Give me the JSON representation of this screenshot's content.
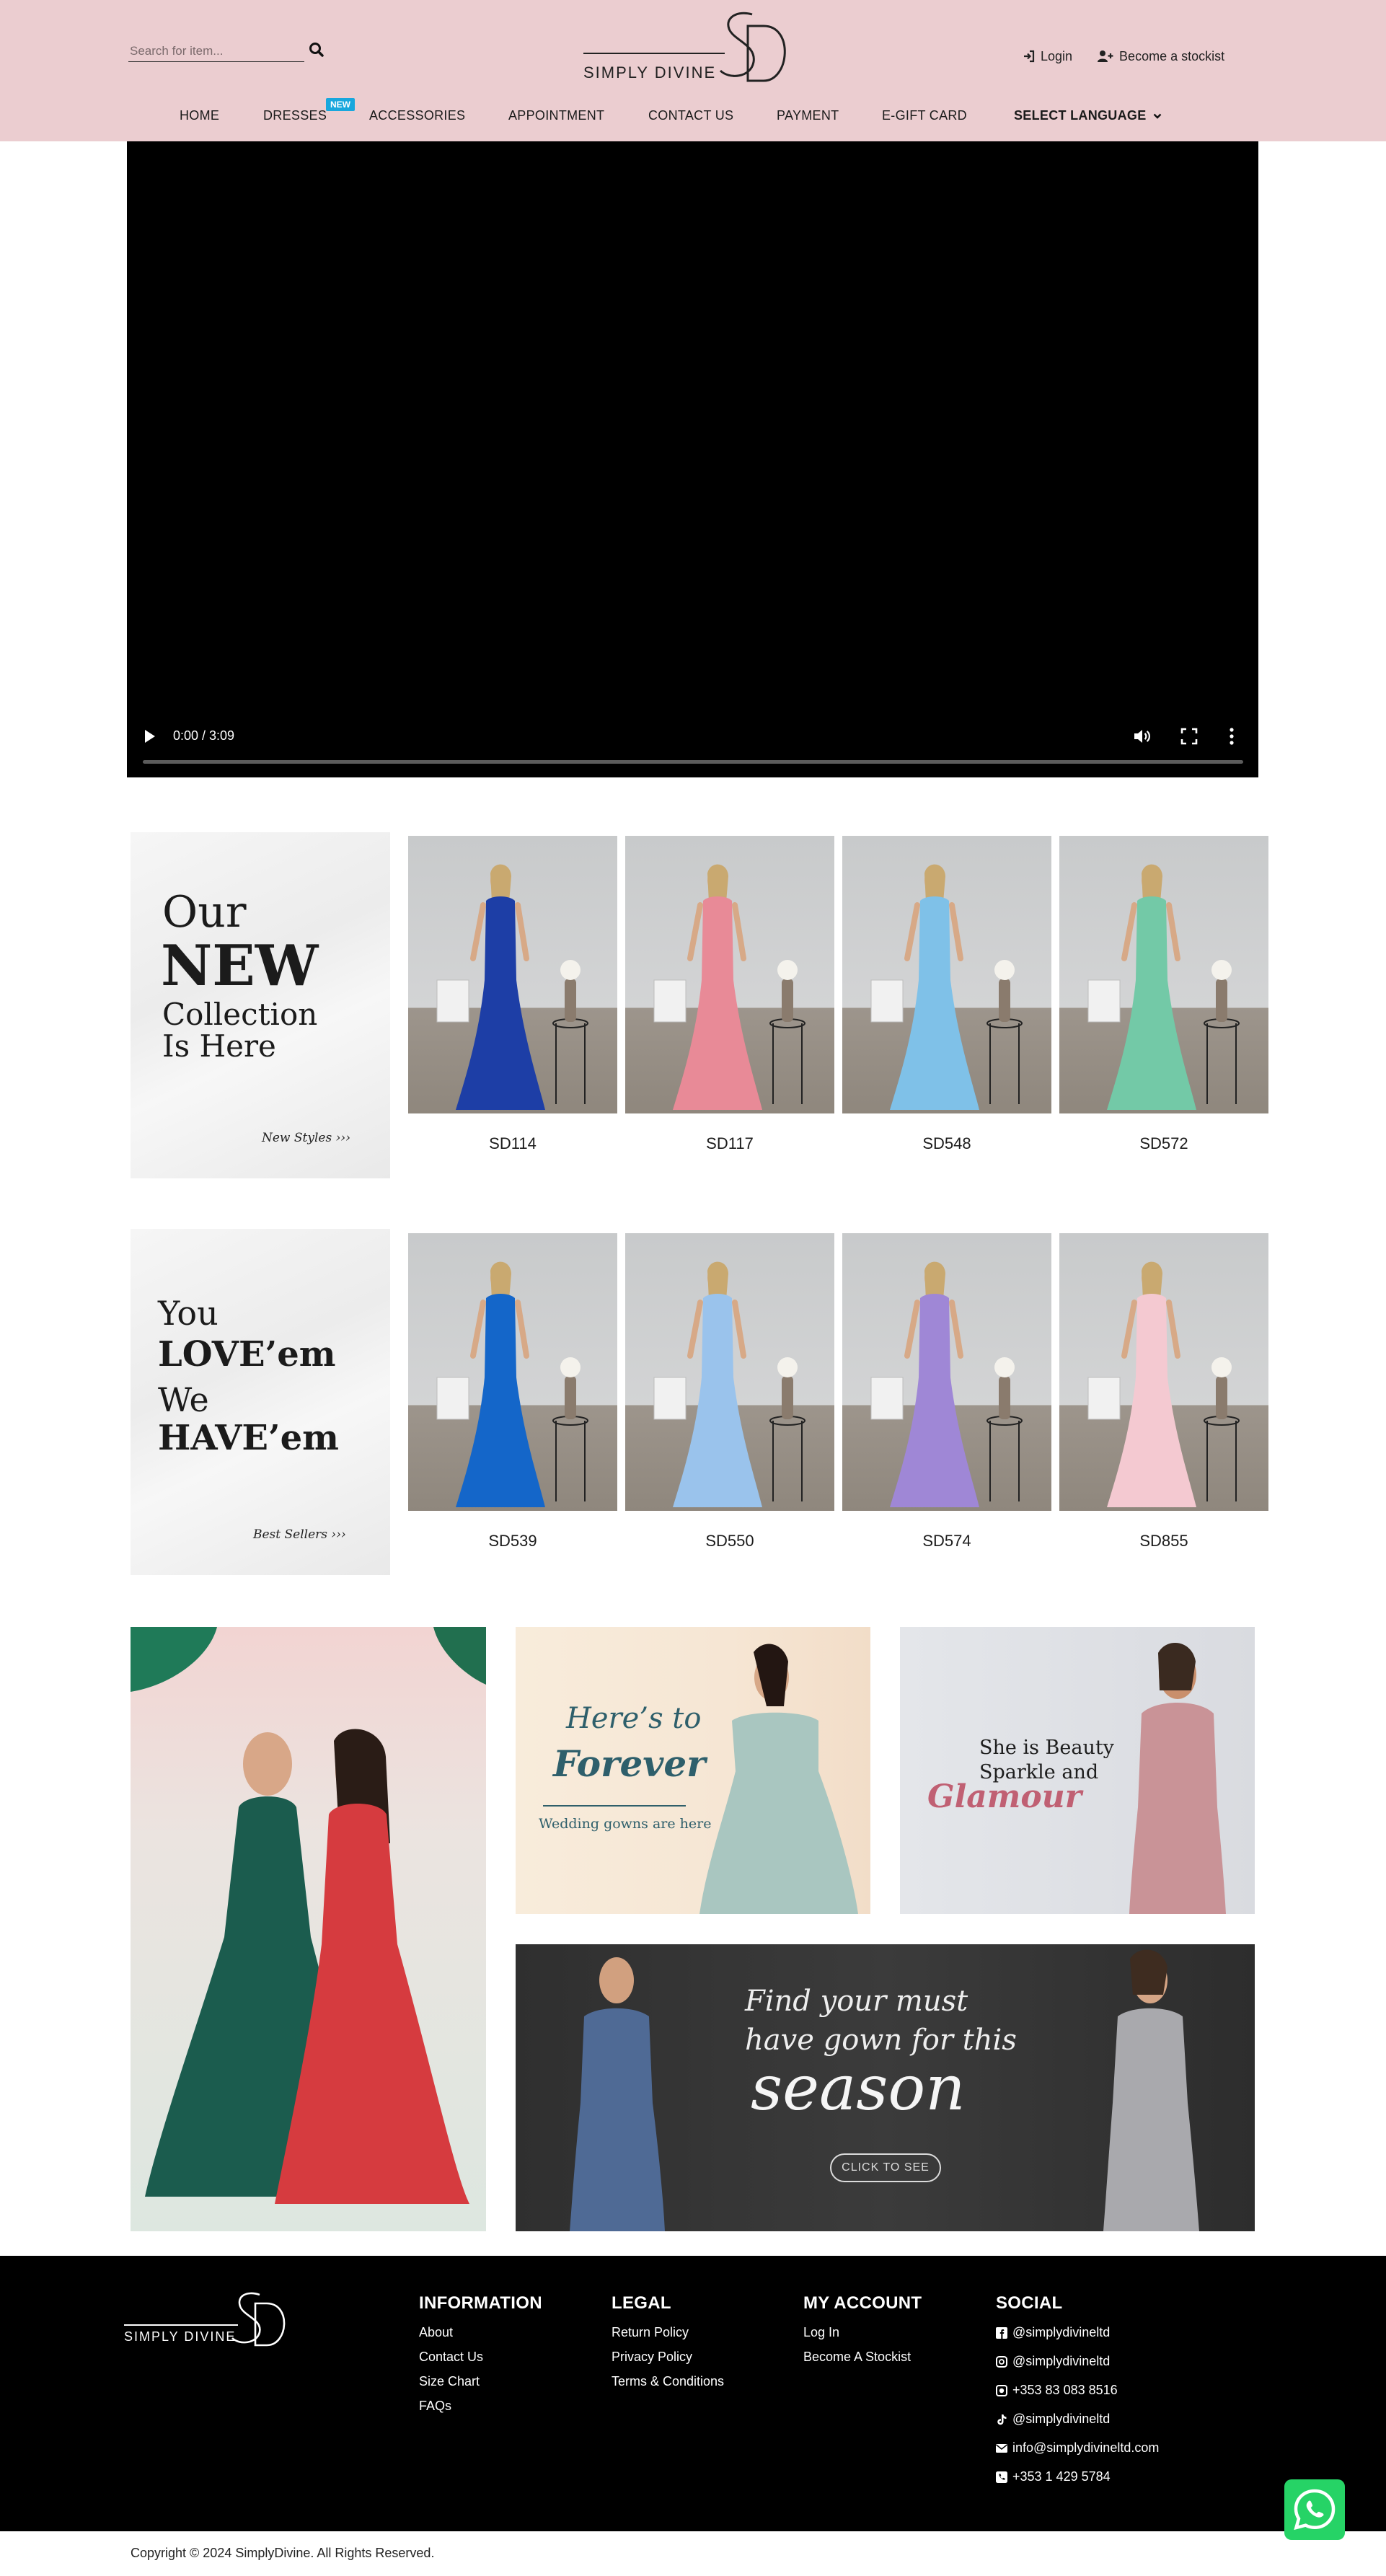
{
  "header": {
    "search_placeholder": "Search for item...",
    "logo_text": "SIMPLY DIVINE",
    "login_label": "Login",
    "stockist_label": "Become a stockist"
  },
  "nav": {
    "items": [
      "HOME",
      "DRESSES",
      "ACCESSORIES",
      "APPOINTMENT",
      "CONTACT US",
      "PAYMENT",
      "E-GIFT CARD",
      "SELECT LANGUAGE"
    ],
    "new_badge": "NEW"
  },
  "video": {
    "time": "0:00 / 3:09",
    "progress": 0
  },
  "new_collection": {
    "lines": [
      "Our",
      "NEW",
      "Collection",
      "Is Here"
    ],
    "link": "New Styles ›››",
    "products": [
      "SD114",
      "SD117",
      "SD548",
      "SD572"
    ],
    "dress_colors": [
      "#1d3ea6",
      "#e88a97",
      "#7fc1e8",
      "#73c9a7"
    ]
  },
  "best_sellers": {
    "lines": [
      "You",
      "LOVE’em",
      "We",
      "HAVE’em"
    ],
    "link": "Best Sellers ›››",
    "products": [
      "SD539",
      "SD550",
      "SD574",
      "SD855"
    ],
    "dress_colors": [
      "#1466c9",
      "#9ac3ec",
      "#9f87d6",
      "#f4c9d1"
    ]
  },
  "banners": {
    "forever_line1": "Here’s to",
    "forever_line2": "Forever",
    "forever_line3": "Wedding gowns are here",
    "beauty_line1": "She is Beauty",
    "beauty_line2": "Sparkle and",
    "beauty_line3": "Glamour",
    "season_line1": "Find your must",
    "season_line2": "have gown for this",
    "season_line3": "season",
    "season_cta": "CLICK TO SEE"
  },
  "footer": {
    "logo_text": "SIMPLY DIVINE",
    "information": {
      "title": "INFORMATION",
      "links": [
        "About",
        "Contact Us",
        "Size Chart",
        "FAQs"
      ]
    },
    "legal": {
      "title": "LEGAL",
      "links": [
        "Return Policy",
        "Privacy Policy",
        "Terms & Conditions"
      ]
    },
    "account": {
      "title": "MY ACCOUNT",
      "links": [
        "Log In",
        "Become A Stockist"
      ]
    },
    "social": {
      "title": "SOCIAL",
      "facebook": "@simplydivineltd",
      "instagram": "@simplydivineltd",
      "whatsapp": "+353 83 083 8516",
      "tiktok": "@simplydivineltd",
      "email": "info@simplydivineltd.com",
      "phone": "+353 1 429 5784"
    },
    "copyright": "Copyright © 2024 SimplyDivine. All Rights Reserved."
  }
}
